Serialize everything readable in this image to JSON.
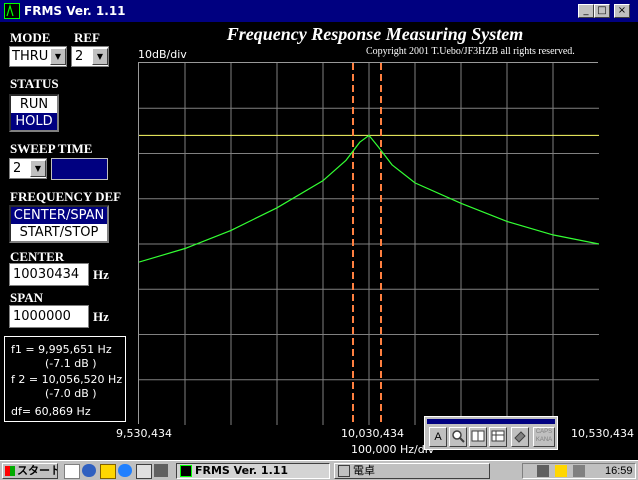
{
  "window": {
    "title": "FRMS Ver. 1.11",
    "controls": [
      "minimize",
      "maximize",
      "close"
    ]
  },
  "app": {
    "title": "Frequency Response Measuring System",
    "copyright": "Copyright 2001 T.Uebo/JF3HZB all rights reserved."
  },
  "controls": {
    "mode": {
      "label": "MODE",
      "value": "THRU"
    },
    "ref": {
      "label": "REF",
      "value": "2"
    },
    "status": {
      "label": "STATUS",
      "options": [
        "RUN",
        "HOLD"
      ],
      "selected": "HOLD"
    },
    "sweep_time": {
      "label": "SWEEP TIME",
      "value": "2"
    },
    "frequency_def": {
      "label": "FREQUENCY DEF",
      "options": [
        "CENTER/SPAN",
        "START/STOP"
      ],
      "selected": "CENTER/SPAN"
    },
    "center": {
      "label": "CENTER",
      "value": "10030434",
      "unit": "Hz"
    },
    "span": {
      "label": "SPAN",
      "value": "1000000",
      "unit": "Hz"
    }
  },
  "readout": {
    "f1": "f1 = 9,995,651 Hz",
    "f1_db": "(-7.1 dB )",
    "f2": "f 2 = 10,056,520 Hz",
    "f2_db": "(-7.0 dB )",
    "df": "df= 60,869 Hz"
  },
  "plot": {
    "y_div_label": "10dB/div",
    "x_div_label": "100,000 Hz/div",
    "freq_start": "9,530,434",
    "freq_center": "10,030,434",
    "freq_end": "10,530,434",
    "colors": {
      "grid": "#808080",
      "ref_line": "#ffff66",
      "response": "#33ff33",
      "markers": "#ff8040"
    },
    "grid_divisions": {
      "x": 10,
      "y": 8
    },
    "freq_range_hz": [
      9530434,
      10530434
    ],
    "ref_level_div": 1.6,
    "markers_hz": [
      9995651,
      10056520
    ],
    "response_curve": [
      [
        9530434,
        4.4
      ],
      [
        9630434,
        4.1
      ],
      [
        9730434,
        3.7
      ],
      [
        9830434,
        3.2
      ],
      [
        9930434,
        2.6
      ],
      [
        9980434,
        2.15
      ],
      [
        10010434,
        1.75
      ],
      [
        10030434,
        1.6
      ],
      [
        10050434,
        1.85
      ],
      [
        10080434,
        2.25
      ],
      [
        10130434,
        2.65
      ],
      [
        10230434,
        3.1
      ],
      [
        10330434,
        3.5
      ],
      [
        10430434,
        3.8
      ],
      [
        10530434,
        4.0
      ]
    ]
  },
  "ime_toolbar": {
    "buttons": [
      "A",
      "magnifier-icon",
      "book-icon",
      "table-icon",
      "eraser-icon",
      "CAPS KANA"
    ]
  },
  "taskbar": {
    "start_label": "スタート",
    "tasks": [
      {
        "label": "FRMS Ver. 1.11",
        "active": true
      },
      {
        "label": "電卓",
        "active": false
      }
    ],
    "clock": "16:59"
  }
}
